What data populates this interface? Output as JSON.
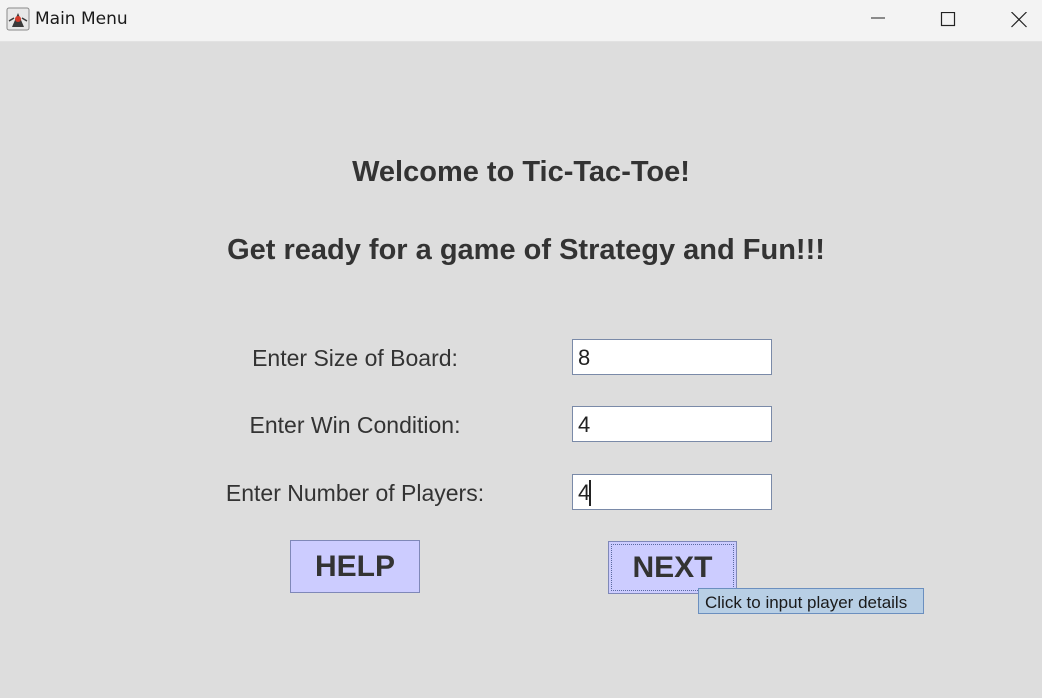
{
  "window": {
    "title": "Main Menu",
    "app_icon": "java-duke-icon",
    "controls": [
      "minimize-icon",
      "maximize-icon",
      "close-icon"
    ]
  },
  "main": {
    "heading": "Welcome to Tic-Tac-Toe!",
    "subheading": "Get ready for a game of Strategy and Fun!!!"
  },
  "form": {
    "board_size": {
      "label": "Enter Size of Board:",
      "value": "8"
    },
    "win_condition": {
      "label": "Enter Win Condition:",
      "value": "4"
    },
    "num_players": {
      "label": "Enter Number of Players:",
      "value": "4"
    }
  },
  "buttons": {
    "help": "HELP",
    "next": "NEXT"
  },
  "tooltip": "Click to input player details",
  "colors": {
    "background": "#dddddd",
    "button_fill": "#ccccff",
    "tooltip_fill": "#b8cfe5",
    "text": "#333333"
  }
}
